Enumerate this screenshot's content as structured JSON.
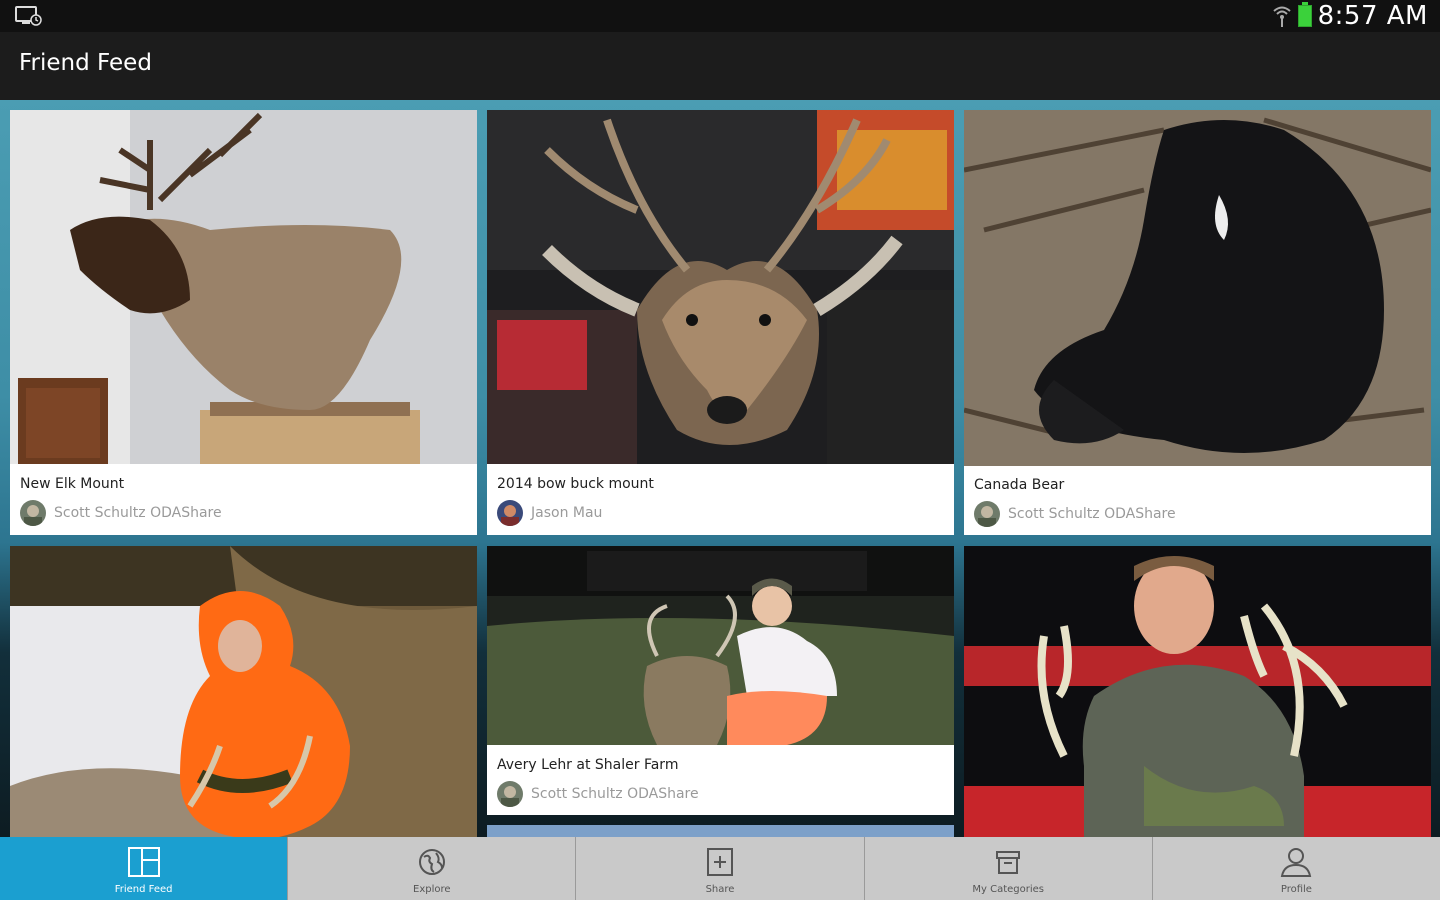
{
  "status_bar": {
    "time": "8:57 AM"
  },
  "action_bar": {
    "title": "Friend Feed"
  },
  "feed": {
    "cards": [
      {
        "title": "New Elk Mount",
        "author": "Scott Schultz ODAShare"
      },
      {
        "title": "2014  bow buck mount",
        "author": "Jason Mau"
      },
      {
        "title": "Canada Bear",
        "author": "Scott Schultz ODAShare"
      },
      {
        "title": "",
        "author": ""
      },
      {
        "title": "Avery Lehr at Shaler Farm",
        "author": "Scott Schultz ODAShare"
      },
      {
        "title": "",
        "author": ""
      }
    ]
  },
  "bottom_nav": {
    "items": [
      {
        "label": "Friend Feed",
        "icon": "feed-grid-icon",
        "active": true
      },
      {
        "label": "Explore",
        "icon": "globe-icon",
        "active": false
      },
      {
        "label": "Share",
        "icon": "share-plus-icon",
        "active": false
      },
      {
        "label": "My Categories",
        "icon": "archive-box-icon",
        "active": false
      },
      {
        "label": "Profile",
        "icon": "user-icon",
        "active": false
      }
    ]
  },
  "colors": {
    "accent": "#1b9fd0",
    "nav_bg": "#c9c9c9",
    "action_bar": "#1c1c1c"
  }
}
